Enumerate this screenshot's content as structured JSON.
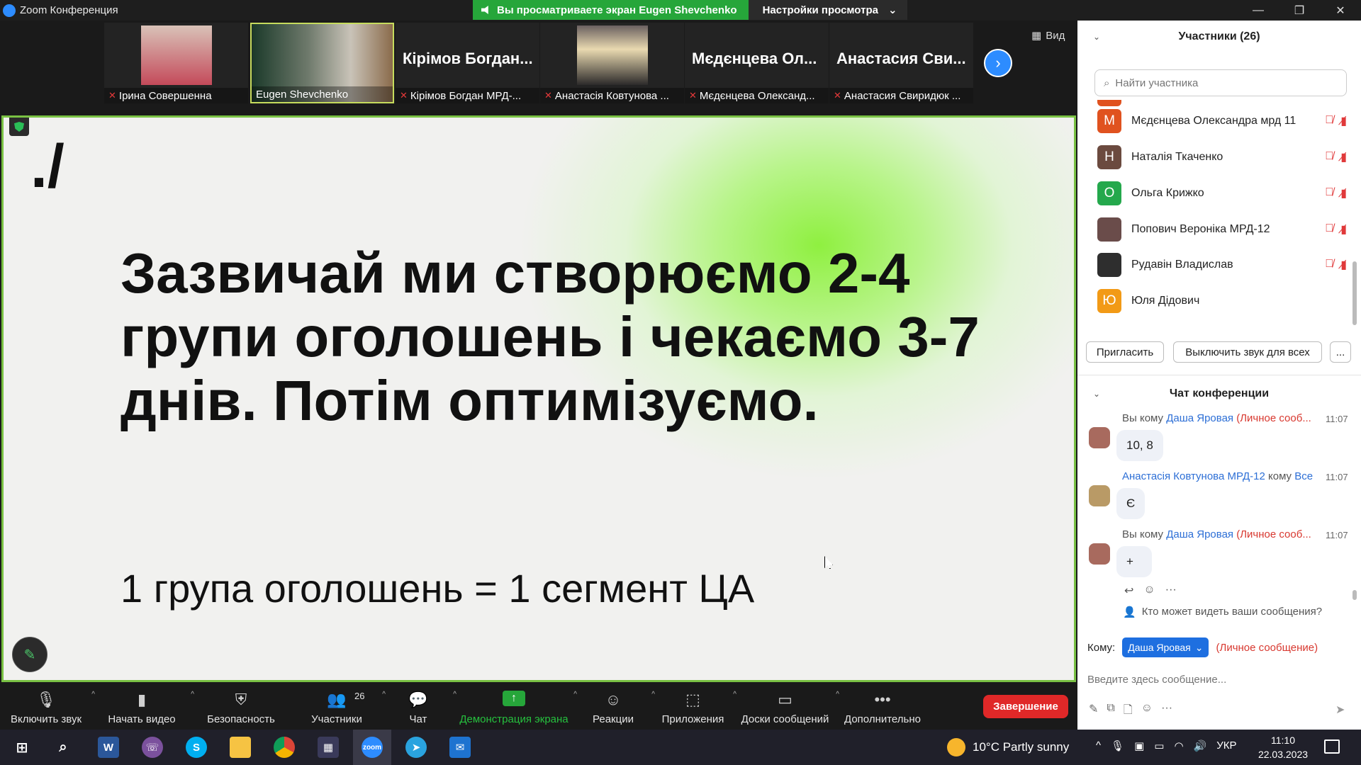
{
  "window": {
    "title": "Zoom Конференция"
  },
  "banner": {
    "viewing": "Вы просматриваете экран Eugen Shevchenko",
    "settings": "Настройки просмотра"
  },
  "video": {
    "view_label": "Вид",
    "tiles": [
      {
        "name": "Ірина Совершенна",
        "muted": true
      },
      {
        "name": "Eugen Shevchenko",
        "muted": false
      },
      {
        "big": "Кірімов Богдан...",
        "name": "Кірімов Богдан МРД-...",
        "muted": true
      },
      {
        "name": "Анастасія Ковтунова ...",
        "muted": true
      },
      {
        "big": "Мєдєнцева Ол...",
        "name": "Мєдєнцева Олександ...",
        "muted": true
      },
      {
        "big": "Анастасия Сви...",
        "name": "Анастасия Свиридюк ...",
        "muted": true
      }
    ]
  },
  "slide": {
    "logo": "./",
    "heading": "Зазвичай ми створюємо 2-4 групи оголошень і чекаємо 3-7 днів. Потім оптимізуємо.",
    "subtext": "1 група оголошень = 1 сегмент ЦА"
  },
  "toolbar": {
    "mute": "Включить звук",
    "video": "Начать видео",
    "security": "Безопасность",
    "participants": "Участники",
    "participants_count": "26",
    "chat": "Чат",
    "share": "Демонстрация экрана",
    "reactions": "Реакции",
    "apps": "Приложения",
    "whiteboards": "Доски сообщений",
    "more": "Дополнительно",
    "end": "Завершение"
  },
  "participants_panel": {
    "title": "Участники (26)",
    "search_placeholder": "Найти участника",
    "items": [
      {
        "initial": "М",
        "color": "#e0521f",
        "name": "Мєдєнцева Олександра мрд 11",
        "muted": true
      },
      {
        "initial": "Н",
        "color": "#6b4a3f",
        "name": "Наталія Ткаченко",
        "muted": true
      },
      {
        "initial": "О",
        "color": "#24a84c",
        "name": "Ольга Крижко",
        "muted": true
      },
      {
        "initial": "",
        "color": "#6a4c4a",
        "name": "Попович Вероніка МРД-12",
        "muted": true
      },
      {
        "initial": "",
        "color": "#2e2e2e",
        "name": "Рудавін Владислав",
        "muted": true
      },
      {
        "initial": "Ю",
        "color": "#f29a16",
        "name": "Юля Дідович",
        "muted": false
      }
    ],
    "invite": "Пригласить",
    "mute_all": "Выключить звук для всех",
    "more": "..."
  },
  "chat": {
    "title": "Чат конференции",
    "messages": [
      {
        "from": "Вы",
        "to_word": "кому",
        "to": "Даша Яровая",
        "private": "(Личное сооб...",
        "time": "11:07",
        "text": "10, 8"
      },
      {
        "from": "Анастасія Ковтунова МРД-12",
        "to_word": "кому",
        "to": "Все",
        "private": "",
        "time": "11:07",
        "text": "Є"
      },
      {
        "from": "Вы",
        "to_word": "кому",
        "to": "Даша Яровая",
        "private": "(Личное сооб...",
        "time": "11:07",
        "text": "+"
      }
    ],
    "who_can_see": "Кто может видеть ваши сообщения?",
    "to_label": "Кому:",
    "to_value": "Даша Яровая",
    "private_note": "(Личное сообщение)",
    "input_placeholder": "Введите здесь сообщение..."
  },
  "taskbar": {
    "weather": "10°C  Partly sunny",
    "lang": "УКР",
    "time": "11:10",
    "date": "22.03.2023"
  }
}
